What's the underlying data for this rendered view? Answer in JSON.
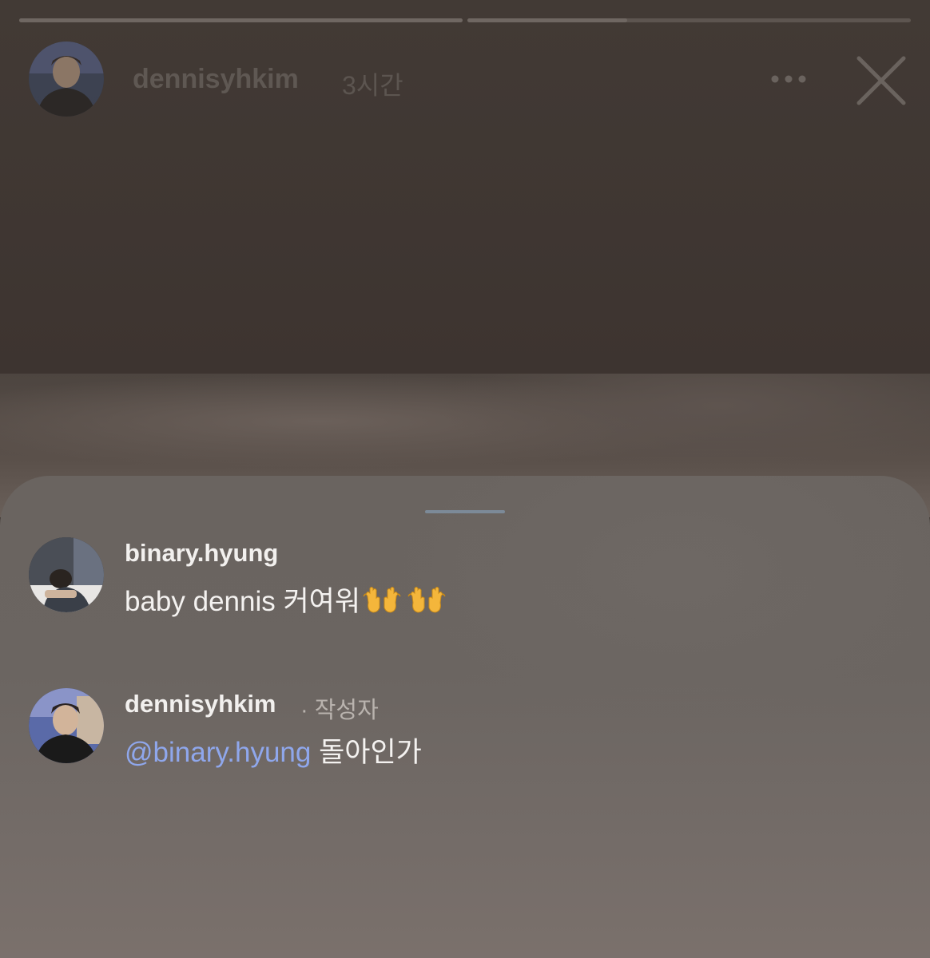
{
  "story": {
    "progress": [
      1.0,
      0.36
    ],
    "username": "dennisyhkim",
    "time_ago": "3시간"
  },
  "comments": [
    {
      "username": "binary.hyung",
      "badge": "",
      "mention": "",
      "text": "baby dennis 커여워",
      "emoji": "raising-hands-emoji x2"
    },
    {
      "username": "dennisyhkim",
      "badge": "· 작성자",
      "mention": "@binary.hyung",
      "text": " 돌아인가",
      "emoji": ""
    }
  ],
  "colors": {
    "mention": "#8fa7ec",
    "sheet": "#6b6561",
    "story_bg": "#3f3732"
  }
}
